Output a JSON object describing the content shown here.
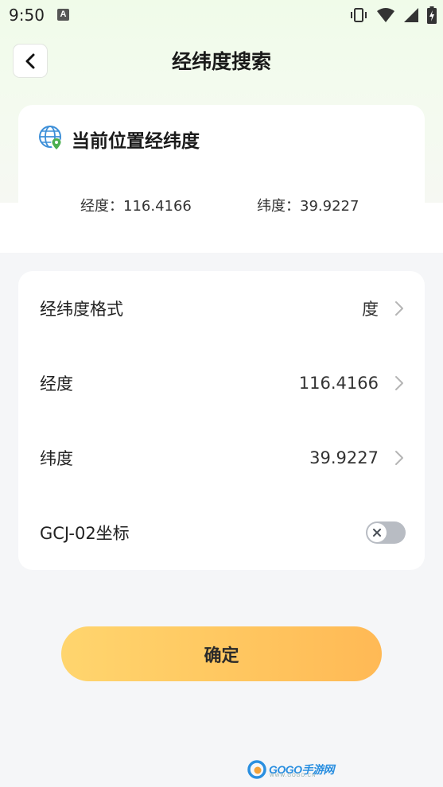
{
  "status_bar": {
    "time": "9:50",
    "notification_letter": "A"
  },
  "header": {
    "title": "经纬度搜索"
  },
  "current_location": {
    "title": "当前位置经纬度",
    "longitude_text": "经度：116.4166",
    "latitude_text": "纬度：39.9227"
  },
  "settings": {
    "rows": [
      {
        "label": "经纬度格式",
        "value": "度"
      },
      {
        "label": "经度",
        "value": "116.4166"
      },
      {
        "label": "纬度",
        "value": "39.9227"
      }
    ],
    "gcj_label": "GCJ-02坐标",
    "gcj_enabled": false
  },
  "confirm_label": "确定",
  "watermark": {
    "text": "GOGO手游网",
    "sub": "WWW.GOGO.CN"
  },
  "colors": {
    "accent_start": "#ffd56e",
    "accent_end": "#ffb955",
    "toggle_off": "#b8bcc3",
    "globe_blue": "#3d8fd8",
    "pin_green": "#4caf50"
  }
}
